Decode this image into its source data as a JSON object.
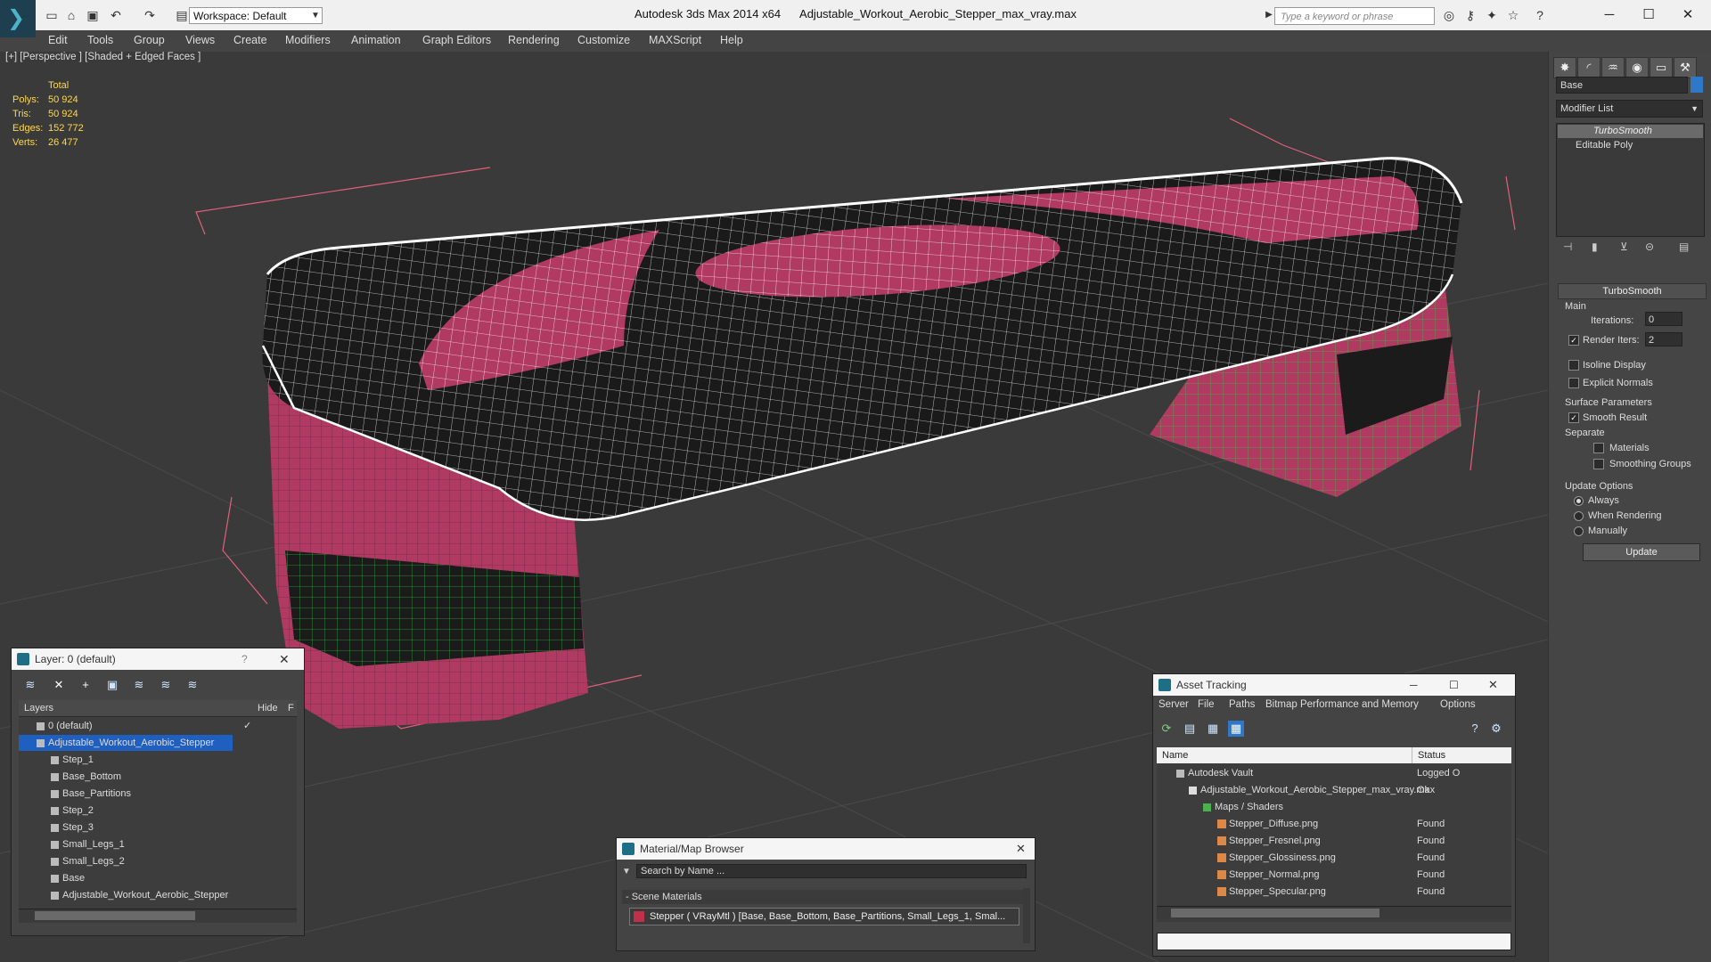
{
  "titlebar": {
    "workspace": "Workspace: Default",
    "app_title": "Autodesk 3ds Max  2014 x64",
    "file_name": "Adjustable_Workout_Aerobic_Stepper_max_vray.max",
    "search_placeholder": "Type a keyword or phrase"
  },
  "menu": [
    "Edit",
    "Tools",
    "Group",
    "Views",
    "Create",
    "Modifiers",
    "Animation",
    "Graph Editors",
    "Rendering",
    "Customize",
    "MAXScript",
    "Help"
  ],
  "viewport": {
    "label": "[+] [Perspective ] [Shaded + Edged Faces ]",
    "stats": {
      "header": "Total",
      "polys_label": "Polys:",
      "polys": "50 924",
      "tris_label": "Tris:",
      "tris": "50 924",
      "edges_label": "Edges:",
      "edges": "152 772",
      "verts_label": "Verts:",
      "verts": "26 477"
    },
    "colors": {
      "background": "#3a3a3a",
      "body": "#1a1a1a",
      "accent": "#b03a62",
      "wire": "#ffffff",
      "legs_wire": "#2ecc40",
      "bbox": "#e0607a"
    }
  },
  "command_panel": {
    "object_name": "Base",
    "modifier_list": "Modifier List",
    "stack": [
      "TurboSmooth",
      "Editable Poly"
    ],
    "turbosmooth_title": "TurboSmooth",
    "main_label": "Main",
    "iterations_label": "Iterations:",
    "iterations": "0",
    "render_iters_label": "Render Iters:",
    "render_iters": "2",
    "isoline_display": "Isoline Display",
    "explicit_normals": "Explicit Normals",
    "surface_params": "Surface Parameters",
    "smooth_result": "Smooth Result",
    "separate": "Separate",
    "materials": "Materials",
    "smoothing_groups": "Smoothing Groups",
    "update_options": "Update Options",
    "always": "Always",
    "when_rendering": "When Rendering",
    "manually": "Manually",
    "update_button": "Update"
  },
  "layer_panel": {
    "title": "Layer: 0 (default)",
    "help": "?",
    "col_layers": "Layers",
    "col_hide": "Hide",
    "col_f": "F",
    "rows": [
      "0 (default)",
      "Adjustable_Workout_Aerobic_Stepper",
      "Step_1",
      "Base_Bottom",
      "Base_Partitions",
      "Step_2",
      "Step_3",
      "Small_Legs_1",
      "Small_Legs_2",
      "Base",
      "Adjustable_Workout_Aerobic_Stepper"
    ]
  },
  "material_browser": {
    "title": "Material/Map Browser",
    "search_placeholder": "Search by Name ...",
    "section": "- Scene Materials",
    "item": "Stepper ( VRayMtl ) [Base, Base_Bottom, Base_Partitions, Small_Legs_1, Smal..."
  },
  "asset_tracking": {
    "title": "Asset Tracking",
    "menu": [
      "Server",
      "File",
      "Paths",
      "Bitmap Performance and Memory",
      "Options"
    ],
    "col_name": "Name",
    "col_status": "Status",
    "rows": [
      {
        "name": "Autodesk Vault",
        "status": "Logged O"
      },
      {
        "name": "Adjustable_Workout_Aerobic_Stepper_max_vray.max",
        "status": "Ok"
      },
      {
        "name": "Maps / Shaders",
        "status": ""
      },
      {
        "name": "Stepper_Diffuse.png",
        "status": "Found"
      },
      {
        "name": "Stepper_Fresnel.png",
        "status": "Found"
      },
      {
        "name": "Stepper_Glossiness.png",
        "status": "Found"
      },
      {
        "name": "Stepper_Normal.png",
        "status": "Found"
      },
      {
        "name": "Stepper_Specular.png",
        "status": "Found"
      }
    ]
  }
}
